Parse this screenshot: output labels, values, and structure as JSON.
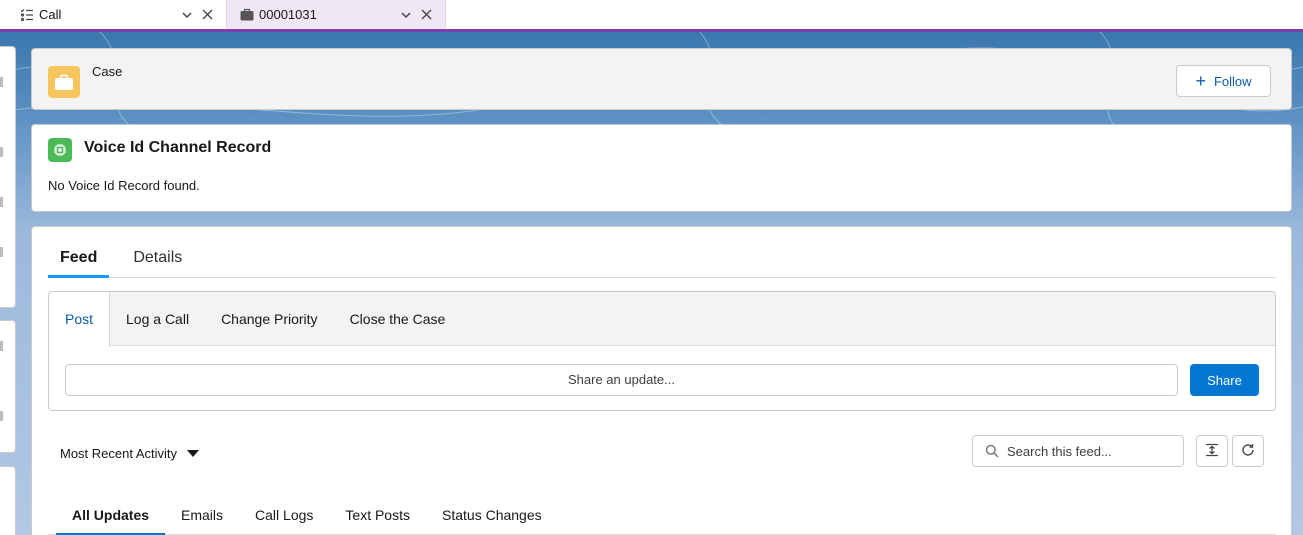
{
  "tabs": [
    {
      "label": "Call",
      "icon": "call-list-icon"
    },
    {
      "label": "00001031",
      "icon": "briefcase-icon"
    }
  ],
  "colors": {
    "accent_bar": "#7b3fb0",
    "active_tab_bg": "#efe6f6",
    "case_icon": "#f6c55b",
    "voice_icon": "#4bbb5a",
    "primary_button": "#0176d3",
    "link_blue": "#0b5cab"
  },
  "case_header": {
    "label": "Case",
    "follow_label": "Follow"
  },
  "voice_card": {
    "title": "Voice Id Channel Record",
    "message": "No Voice Id Record found."
  },
  "feed": {
    "main_tabs": [
      "Feed",
      "Details"
    ],
    "publisher_tabs": [
      "Post",
      "Log a Call",
      "Change Priority",
      "Close the Case"
    ],
    "share_placeholder": "Share an update...",
    "share_label": "Share",
    "sort_label": "Most Recent Activity",
    "search_placeholder": "Search this feed...",
    "filter_tabs": [
      "All Updates",
      "Emails",
      "Call Logs",
      "Text Posts",
      "Status Changes"
    ]
  }
}
